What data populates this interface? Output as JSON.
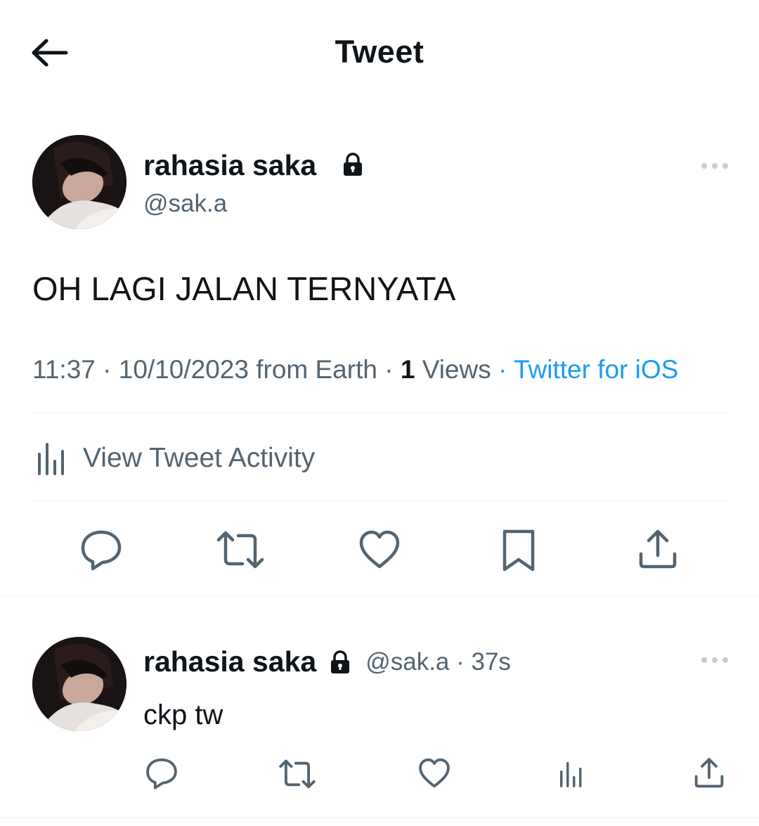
{
  "header": {
    "title": "Tweet"
  },
  "tweet": {
    "author": {
      "name": "rahasia saka",
      "handle": "@sak.a"
    },
    "text": "OH LAGI JALAN TERNYATA",
    "time": "11:37",
    "date": "10/10/2023",
    "location": "from Earth",
    "views_count": "1",
    "views_label": "Views",
    "source": "Twitter for iOS",
    "activity_label": "View Tweet Activity"
  },
  "reply": {
    "author": {
      "name": "rahasia saka",
      "handle": "@sak.a"
    },
    "age": "37s",
    "text": "ckp tw"
  },
  "colors": {
    "accent": "#1d9bf0",
    "icon": "#536471",
    "text": "#0f1419"
  },
  "icons": [
    "back-arrow-icon",
    "lock-icon",
    "more-icon",
    "reply-icon",
    "retweet-icon",
    "like-icon",
    "bookmark-icon",
    "share-icon",
    "analytics-icon"
  ]
}
